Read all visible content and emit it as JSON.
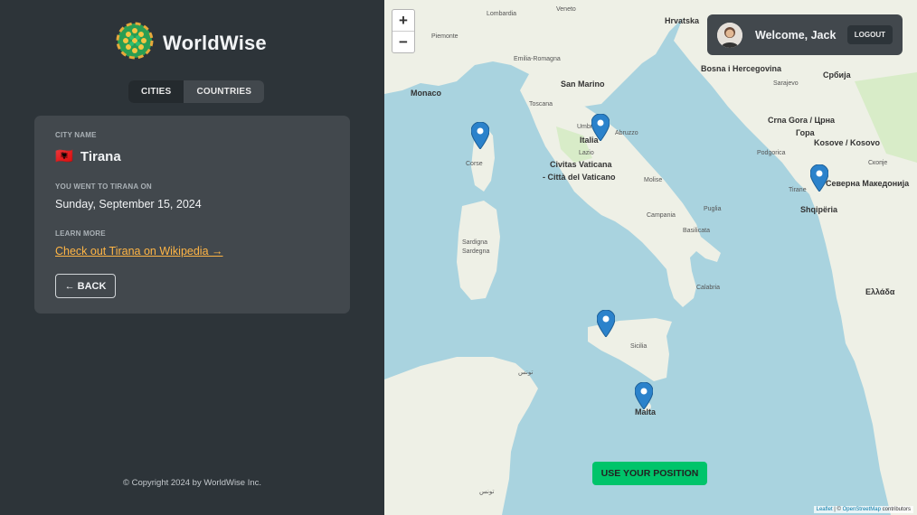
{
  "app": {
    "name": "WorldWise"
  },
  "tabs": [
    {
      "label": "CITIES",
      "active": true
    },
    {
      "label": "COUNTRIES",
      "active": false
    }
  ],
  "city": {
    "name_label": "CITY NAME",
    "flag": "🇦🇱",
    "name": "Tirana",
    "visit_label": "YOU WENT TO TIRANA ON",
    "visit_date": "Sunday, September 15, 2024",
    "learn_label": "LEARN MORE",
    "wiki_link": "Check out Tirana on Wikipedia →",
    "back_label": "← BACK"
  },
  "footer": {
    "copyright": "© Copyright 2024 by WorldWise Inc."
  },
  "map": {
    "zoom_in": "+",
    "zoom_out": "−",
    "use_position": "USE YOUR POSITION",
    "attribution_leaflet": "Leaflet",
    "attribution_sep": " | © ",
    "attribution_osm": "OpenStreetMap",
    "attribution_tail": " contributors",
    "pin_color": "#2b82cb",
    "labels": {
      "monaco": "Monaco",
      "san_marino": "San Marino",
      "italia": "Italia",
      "vaticano1": "Civitas Vaticana",
      "vaticano2": "- Città del Vaticano",
      "hrvatska": "Hrvatska",
      "bosna": "Bosna i Hercegovina",
      "srbija": "Србија",
      "sarajevo": "Sarajevo",
      "crna_gora1": "Crna Gora / Црна",
      "crna_gora2": "Гора",
      "kosovo": "Kosove / Kosovo",
      "podgorica": "Podgorica",
      "skopje": "Скопје",
      "tirane": "Tirane",
      "makedonija": "Северна Македонија",
      "shqiperia": "Shqipëria",
      "ellada": "Ελλάδα",
      "sardegna1": "Sardigna",
      "sardegna2": "Sardegna",
      "sicilia": "Sicilia",
      "malta": "Malta",
      "tunis1": "تونس",
      "tunis2": "تونس",
      "lombardia": "Lombardia",
      "veneto": "Veneto",
      "piemonte": "Piemonte",
      "emilia": "Emilia-Romagna",
      "toscana": "Toscana",
      "lazio": "Lazio",
      "campania": "Campania",
      "puglia": "Puglia",
      "calabria": "Calabria",
      "basilicata": "Basilicata",
      "molise": "Molise",
      "abruzzo": "Abruzzo",
      "umbria": "Umbria",
      "corse": "Corse"
    }
  },
  "user": {
    "welcome": "Welcome, Jack",
    "logout": "LOGOUT"
  }
}
